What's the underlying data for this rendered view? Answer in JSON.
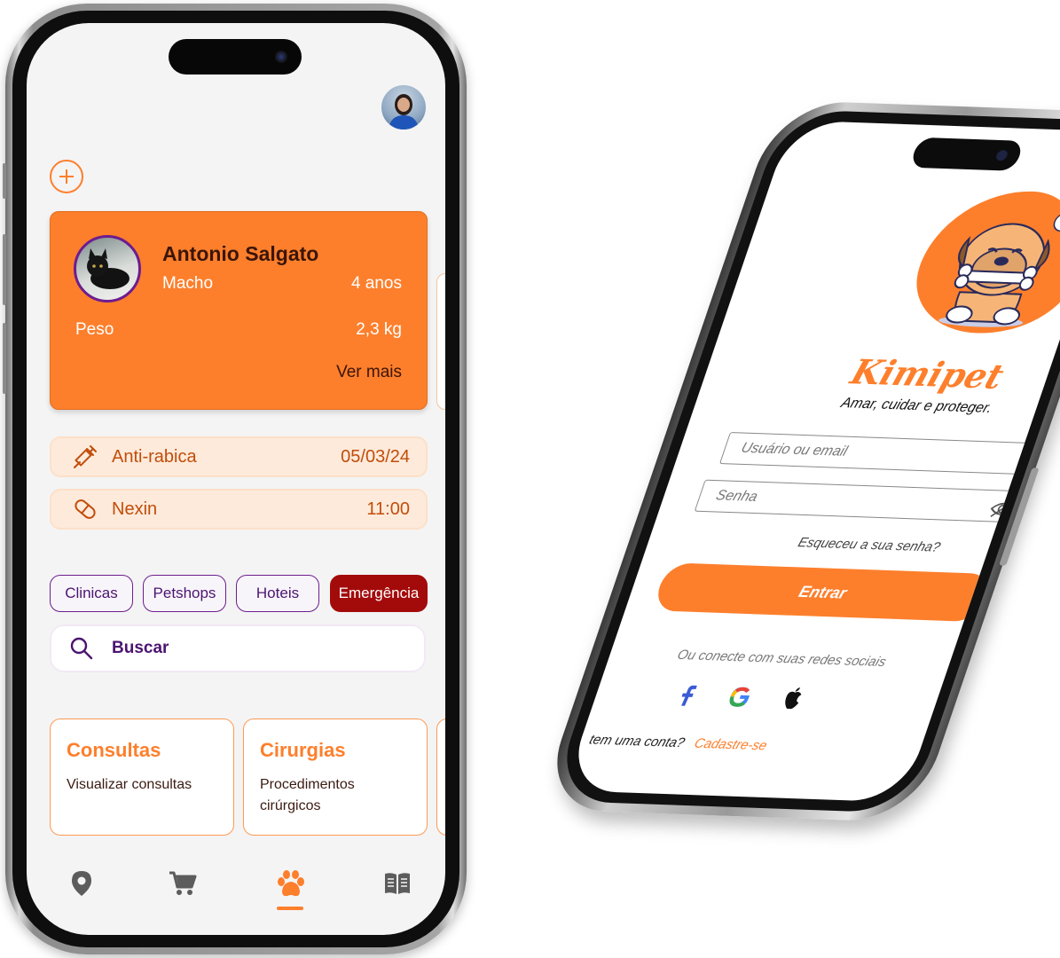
{
  "pets_screen": {
    "pet": {
      "name": "Antonio Salgato",
      "sex": "Macho",
      "age": "4 anos",
      "weight_label": "Peso",
      "weight": "2,3 kg",
      "more": "Ver mais"
    },
    "reminders": [
      {
        "label": "Anti-rabica",
        "value": "05/03/24",
        "icon": "syringe-icon"
      },
      {
        "label": "Nexin",
        "value": "11:00",
        "icon": "pill-icon"
      }
    ],
    "chips": [
      "Clinicas",
      "Petshops",
      "Hoteis",
      "Emergência"
    ],
    "search": {
      "label": "Buscar",
      "icon": "search-icon"
    },
    "services": [
      {
        "title": "Consultas",
        "desc": "Visualizar consultas"
      },
      {
        "title": "Cirurgias",
        "desc": "Procedimentos cirúrgicos"
      }
    ],
    "nav": [
      {
        "name": "map-pin-icon",
        "active": false
      },
      {
        "name": "cart-icon",
        "active": false
      },
      {
        "name": "paw-icon",
        "active": true
      },
      {
        "name": "book-icon",
        "active": false
      }
    ]
  },
  "login_screen": {
    "brand": "Kimipet",
    "tagline": "Amar, cuidar e proteger.",
    "user_placeholder": "Usuário ou email",
    "password_placeholder": "Senha",
    "forgot": "Esqueceu a sua senha?",
    "submit": "Entrar",
    "social_text": "Ou conecte com suas redes sociais",
    "signup_prompt": "tem uma conta?",
    "signup_link": "Cadastre-se"
  },
  "colors": {
    "accent": "#fd7f2c",
    "purple": "#6d1d8e",
    "emergency": "#a30b0b",
    "reminder_bg": "#fdeadb"
  }
}
